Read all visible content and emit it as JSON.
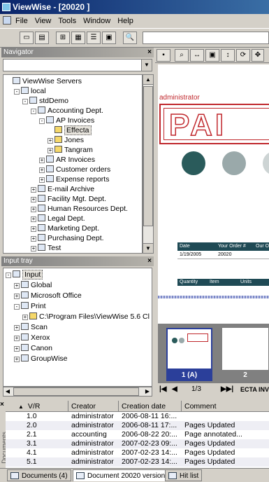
{
  "window": {
    "title": "ViewWise - [20020 ]"
  },
  "menu": [
    "File",
    "View",
    "Tools",
    "Window",
    "Help"
  ],
  "navigator": {
    "title": "Navigator",
    "tree": [
      {
        "label": "ViewWise Servers",
        "level": 0,
        "icon": "servers-icon"
      },
      {
        "label": "local",
        "level": 1,
        "icon": "server-icon",
        "exp": "-"
      },
      {
        "label": "stdDemo",
        "level": 2,
        "icon": "database-icon",
        "exp": "-"
      },
      {
        "label": "Accounting Dept.",
        "level": 3,
        "icon": "cabinet-icon",
        "exp": "-"
      },
      {
        "label": "AP Invoices",
        "level": 4,
        "icon": "drawer-icon",
        "exp": "-"
      },
      {
        "label": "Effecta",
        "level": 5,
        "icon": "folder-icon",
        "selected": true
      },
      {
        "label": "Jones",
        "level": 5,
        "icon": "folder-icon",
        "exp": "+"
      },
      {
        "label": "Tangram",
        "level": 5,
        "icon": "folder-icon",
        "exp": "+"
      },
      {
        "label": "AR Invoices",
        "level": 4,
        "icon": "drawer-icon",
        "exp": "+"
      },
      {
        "label": "Customer orders",
        "level": 4,
        "icon": "drawer-icon",
        "exp": "+"
      },
      {
        "label": "Expense reports",
        "level": 4,
        "icon": "drawer-icon",
        "exp": "+"
      },
      {
        "label": "E-mail Archive",
        "level": 3,
        "icon": "cabinet-icon",
        "exp": "+"
      },
      {
        "label": "Facility Mgt. Dept.",
        "level": 3,
        "icon": "cabinet-icon",
        "exp": "+"
      },
      {
        "label": "Human Resources Dept.",
        "level": 3,
        "icon": "cabinet-icon",
        "exp": "+"
      },
      {
        "label": "Legal Dept.",
        "level": 3,
        "icon": "cabinet-icon",
        "exp": "+"
      },
      {
        "label": "Marketing Dept.",
        "level": 3,
        "icon": "cabinet-icon",
        "exp": "+"
      },
      {
        "label": "Purchasing Dept.",
        "level": 3,
        "icon": "cabinet-icon",
        "exp": "+"
      },
      {
        "label": "Test",
        "level": 3,
        "icon": "cabinet-icon",
        "exp": "+"
      }
    ]
  },
  "input_tray": {
    "title": "Input tray",
    "tree": [
      {
        "label": "Input",
        "level": 0,
        "icon": "input-icon",
        "exp": "-",
        "selected": true
      },
      {
        "label": "Global",
        "level": 1,
        "icon": "google-icon",
        "exp": "+"
      },
      {
        "label": "Microsoft Office",
        "level": 1,
        "icon": "office-icon",
        "exp": "+"
      },
      {
        "label": "Print",
        "level": 1,
        "icon": "printer-icon",
        "exp": "-"
      },
      {
        "label": "C:\\Program Files\\ViewWise 5.6 Cl",
        "level": 2,
        "icon": "folder-icon",
        "exp": "+"
      },
      {
        "label": "Scan",
        "level": 1,
        "icon": "scanner-icon",
        "exp": "+"
      },
      {
        "label": "Xerox",
        "level": 1,
        "icon": "xerox-icon",
        "exp": "+"
      },
      {
        "label": "Canon",
        "level": 1,
        "icon": "canon-icon",
        "exp": "+"
      },
      {
        "label": "GroupWise",
        "level": 1,
        "icon": "groupwise-icon",
        "exp": "+"
      }
    ]
  },
  "viewer": {
    "doc_user": "administrator",
    "stamp": "PAI",
    "table1": {
      "headers": [
        "Date",
        "Your Order #",
        "Our O"
      ],
      "row": [
        "1/19/2005",
        "20020",
        ""
      ]
    },
    "table2": {
      "headers": [
        "Quantity",
        "Item",
        "Units"
      ]
    },
    "thumb_labels": [
      "1 (A)",
      "2"
    ],
    "page_indicator": "1/3",
    "doc_name": "ECTA INV"
  },
  "grid": {
    "columns": [
      "V/R",
      "Creator",
      "Creation date",
      "Comment"
    ],
    "rows": [
      [
        "1.0",
        "administrator",
        "2006-08-11 16:...",
        ""
      ],
      [
        "2.0",
        "administrator",
        "2006-08-11 17:...",
        "Pages Updated"
      ],
      [
        "2.1",
        "accounting",
        "2006-08-22 20:...",
        "Page annotated..."
      ],
      [
        "3.1",
        "administrator",
        "2007-02-23 09:...",
        "Pages Updated"
      ],
      [
        "4.1",
        "administrator",
        "2007-02-23 14:...",
        "Pages Updated"
      ],
      [
        "5.1",
        "administrator",
        "2007-02-23 14:...",
        "Pages Updated"
      ]
    ]
  },
  "bottom_tabs": [
    "Documents (4)",
    "Document 20020 versions",
    "Hit list"
  ],
  "side_label": "Documents"
}
